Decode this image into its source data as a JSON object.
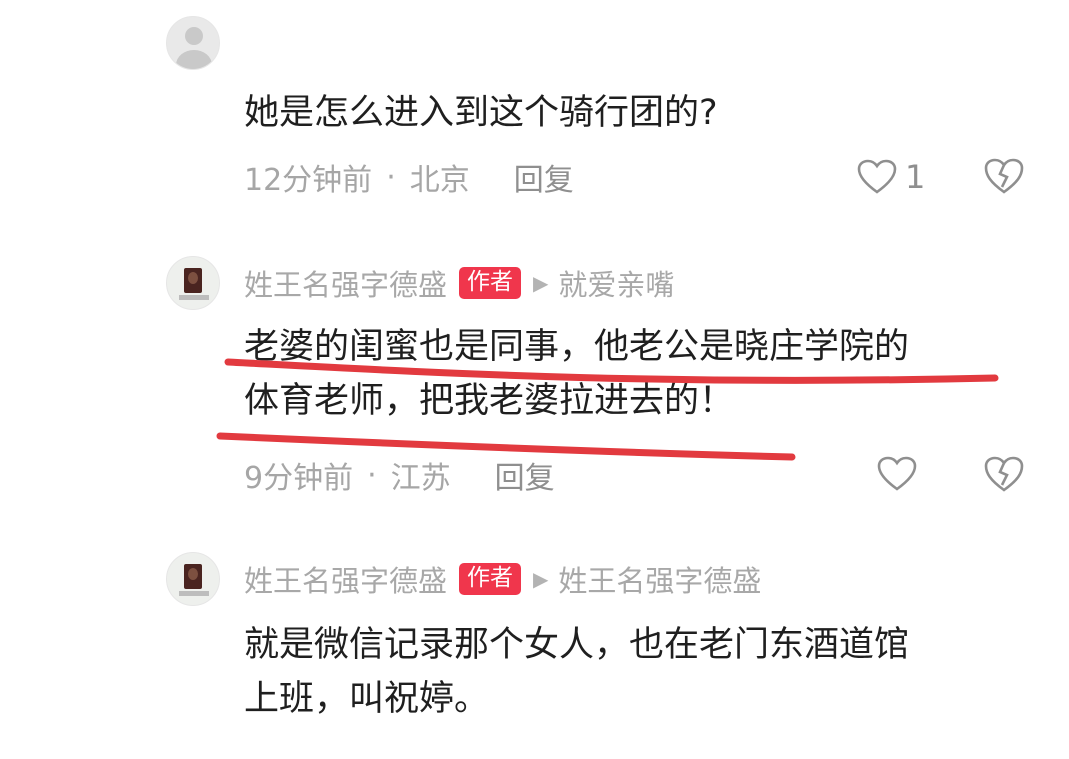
{
  "comments": [
    {
      "text_lines": [
        "她是怎么进入到这个骑行团的?"
      ],
      "time": "12分钟前",
      "location": "北京",
      "reply_label": "回复",
      "likes": "1"
    },
    {
      "author": "姓王名强字德盛",
      "badge": "作者",
      "reply_to": "就爱亲嘴",
      "text_lines": [
        "老婆的闺蜜也是同事，他老公是晓庄学院的",
        "体育老师，把我老婆拉进去的！"
      ],
      "time": "9分钟前",
      "location": "江苏",
      "reply_label": "回复"
    },
    {
      "author": "姓王名强字德盛",
      "badge": "作者",
      "reply_to": "姓王名强字德盛",
      "text_lines": [
        "就是微信记录那个女人，也在老门东酒道馆",
        "上班，叫祝婷。"
      ]
    }
  ],
  "colors": {
    "badge": "#f0364c",
    "underline": "#e23a3f",
    "meta": "#a6a6a6"
  },
  "icons": [
    "user-placeholder-icon",
    "heart-icon",
    "broken-heart-icon",
    "play-triangle-icon"
  ]
}
